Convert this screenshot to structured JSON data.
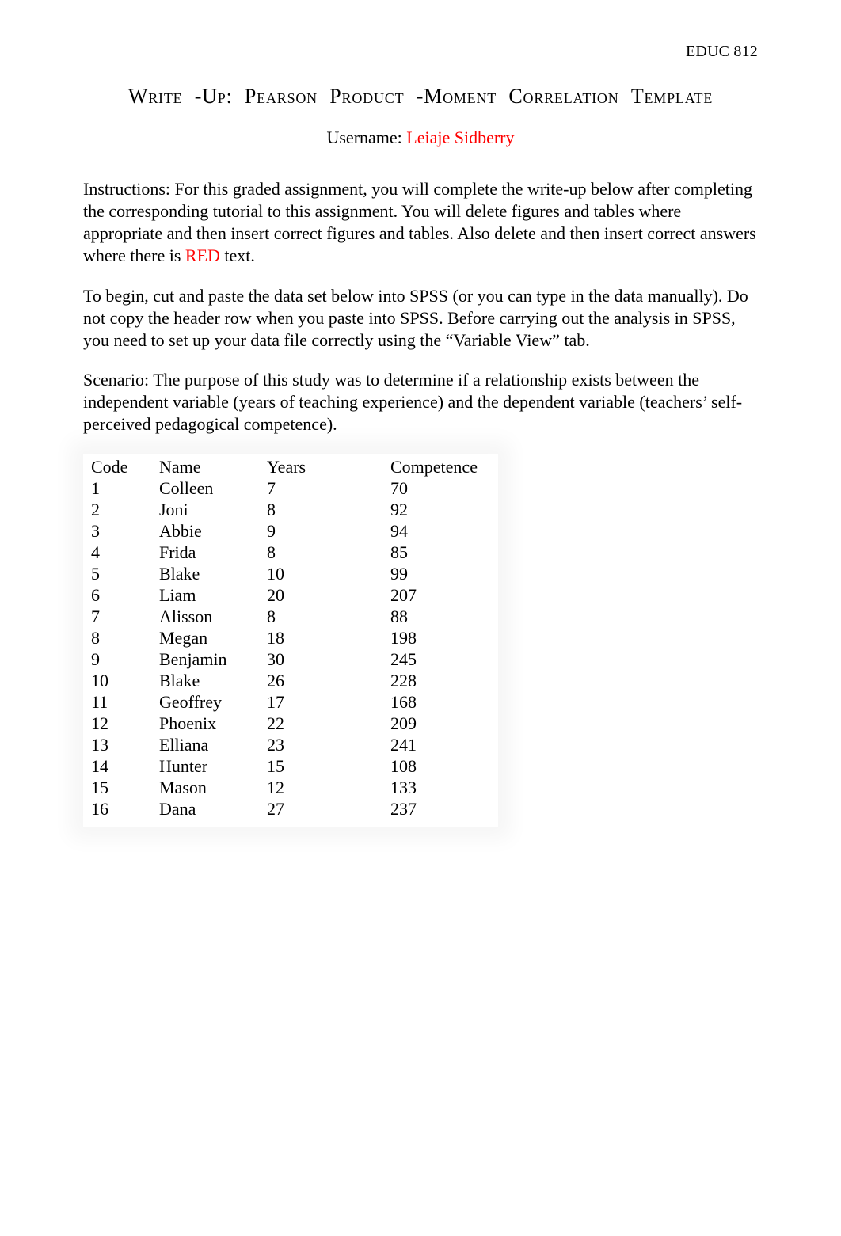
{
  "course_header": "EDUC 812",
  "title_words": [
    "Write",
    "-Up:",
    "Pearson",
    "Product",
    "-Moment",
    "Correlation",
    "Template"
  ],
  "username_label": "Username:  ",
  "username_value": "Leiaje Sidberry",
  "instructions_label": "Instructions:   ",
  "instructions_text_before_red": "For this graded assignment, you will complete the write-up below after completing the corresponding tutorial to this assignment. You will delete figures and tables where appropriate and then insert correct figures and tables. Also delete and then insert correct answers where there is ",
  "instructions_red_word": "RED",
  "instructions_text_after_red": " text.",
  "begin_text": "To begin, cut and paste the data set below into SPSS (or you can type in the data manually).  Do not copy the header row when you paste into SPSS. Before carrying out the analysis in SPSS, you need to set up your data file correctly using the “Variable View” tab.",
  "scenario_label": "Scenario:  ",
  "scenario_text": "The purpose of this study was to determine if a relationship exists between the independent variable (years of teaching experience) and the dependent variable (teachers’ self-perceived pedagogical competence).",
  "table": {
    "headers": {
      "code": "Code",
      "name": "Name",
      "years": "Years",
      "competence": "Competence"
    },
    "rows": [
      {
        "code": "1",
        "name": "Colleen",
        "years": "7",
        "competence": "70"
      },
      {
        "code": "2",
        "name": "Joni",
        "years": "8",
        "competence": "92"
      },
      {
        "code": "3",
        "name": "Abbie",
        "years": "9",
        "competence": "94"
      },
      {
        "code": "4",
        "name": "Frida",
        "years": "8",
        "competence": "85"
      },
      {
        "code": "5",
        "name": "Blake",
        "years": "10",
        "competence": "99"
      },
      {
        "code": "6",
        "name": "Liam",
        "years": "20",
        "competence": "207"
      },
      {
        "code": "7",
        "name": "Alisson",
        "years": "8",
        "competence": "88"
      },
      {
        "code": "8",
        "name": "Megan",
        "years": "18",
        "competence": "198"
      },
      {
        "code": "9",
        "name": "Benjamin",
        "years": "30",
        "competence": "245"
      },
      {
        "code": "10",
        "name": "Blake",
        "years": "26",
        "competence": "228"
      },
      {
        "code": "11",
        "name": "Geoffrey",
        "years": "17",
        "competence": "168"
      },
      {
        "code": "12",
        "name": "Phoenix",
        "years": "22",
        "competence": "209"
      },
      {
        "code": "13",
        "name": "Elliana",
        "years": "23",
        "competence": "241"
      },
      {
        "code": "14",
        "name": "Hunter",
        "years": "15",
        "competence": "108"
      },
      {
        "code": "15",
        "name": "Mason",
        "years": "12",
        "competence": "133"
      },
      {
        "code": "16",
        "name": "Dana",
        "years": "27",
        "competence": "237"
      }
    ]
  }
}
